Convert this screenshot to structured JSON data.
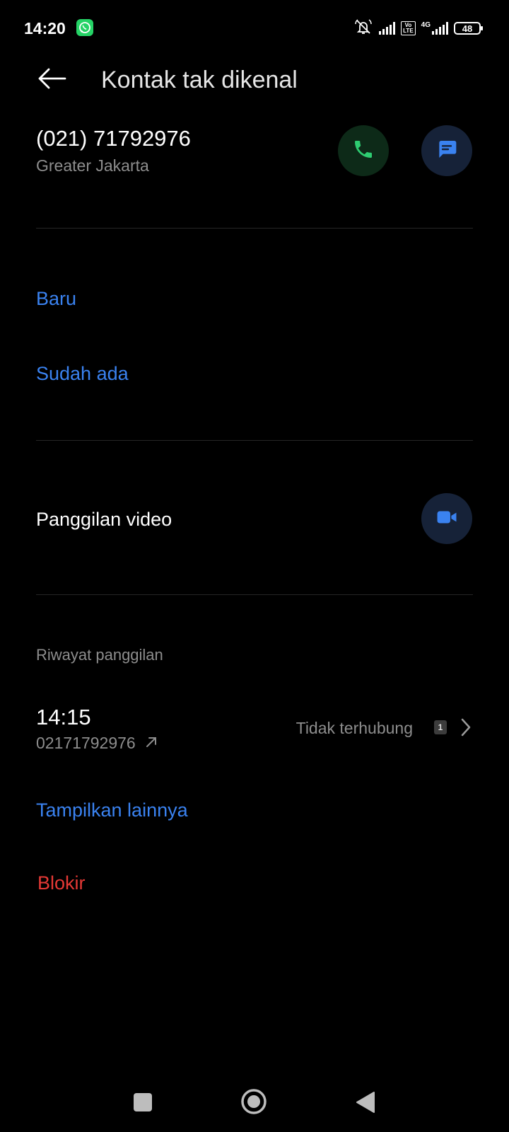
{
  "status_bar": {
    "time": "14:20",
    "network": "4G",
    "volte": "Vo\nLTE",
    "battery": "48"
  },
  "header": {
    "title": "Kontak tak dikenal"
  },
  "contact": {
    "number": "(021) 71792976",
    "location": "Greater Jakarta"
  },
  "actions": {
    "call_icon": "phone-icon",
    "message_icon": "message-icon"
  },
  "add_contact": {
    "new_label": "Baru",
    "existing_label": "Sudah ada"
  },
  "video": {
    "label": "Panggilan video",
    "icon": "video-camera-icon"
  },
  "history": {
    "section_label": "Riwayat panggilan",
    "entries": [
      {
        "time": "14:15",
        "number": "02171792976",
        "status": "Tidak terhubung",
        "sim": "1"
      }
    ],
    "show_more_label": "Tampilkan lainnya"
  },
  "block_label": "Blokir",
  "colors": {
    "accent_blue": "#3a82f0",
    "call_green": "#2ecc71",
    "danger_red": "#e53935",
    "background": "#000000"
  }
}
